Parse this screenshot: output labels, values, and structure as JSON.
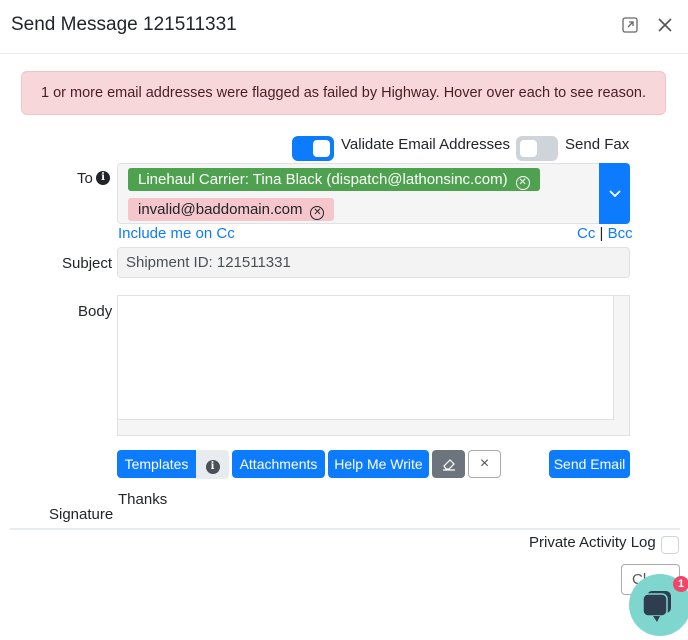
{
  "header": {
    "title": "Send Message 121511331",
    "expand_icon": "expand-icon",
    "close_icon": "close-icon"
  },
  "alert": {
    "text": "1 or more email addresses were flagged as failed by Highway. Hover over each to see reason."
  },
  "toggles": {
    "validate": {
      "label": "Validate Email Addresses",
      "on": true
    },
    "fax": {
      "label": "Send Fax",
      "on": false
    }
  },
  "to": {
    "label": "To",
    "recipients": [
      {
        "text": "Linehaul Carrier: Tina Black (dispatch@lathonsinc.com)",
        "status": "valid",
        "color": "#4ea14e"
      },
      {
        "text": "invalid@baddomain.com",
        "status": "failed",
        "color": "#f8d7da"
      }
    ],
    "include_cc": "Include me on Cc",
    "cc": "Cc",
    "sep": "|",
    "bcc": "Bcc"
  },
  "subject": {
    "label": "Subject",
    "value": "Shipment ID: 121511331"
  },
  "body": {
    "label": "Body",
    "value": ""
  },
  "toolbar": {
    "templates": "Templates",
    "attachments": "Attachments",
    "help": "Help Me Write",
    "send": "Send Email",
    "clear": "×"
  },
  "signature": {
    "label": "Signature",
    "value": "Thanks"
  },
  "footer": {
    "private_log": "Private Activity Log",
    "private_checked": false,
    "close": "Close"
  },
  "chat": {
    "badge": "1"
  },
  "colors": {
    "primary": "#0d7bfd",
    "alert_bg": "#f8d7da",
    "chip_valid": "#4ea14e"
  }
}
